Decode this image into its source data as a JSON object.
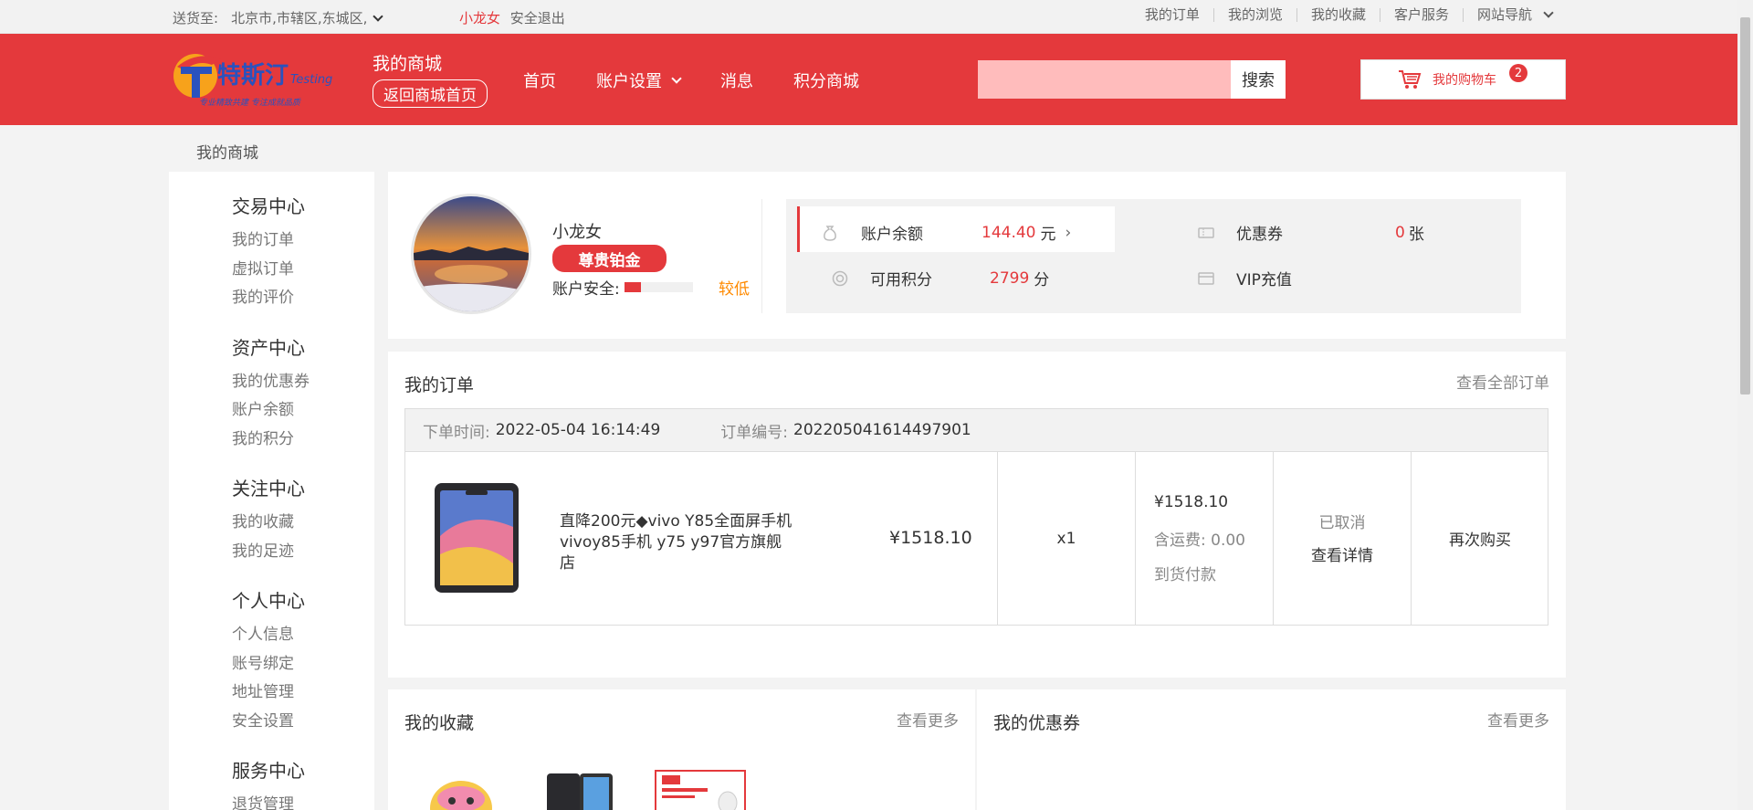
{
  "topbar": {
    "ship_to_label": "送货至:",
    "address": "北京市,市辖区,东城区,",
    "username": "小龙女",
    "logout": "安全退出",
    "links": [
      "我的订单",
      "我的浏览",
      "我的收藏",
      "客户服务",
      "网站导航"
    ]
  },
  "header": {
    "logo_text": "特斯汀",
    "logo_sub": "Testing",
    "logo_slogan": "专业精致共建 专注成就品质",
    "mall_title": "我的商城",
    "back_home": "返回商城首页",
    "nav": [
      "首页",
      "账户设置",
      "消息",
      "积分商城"
    ],
    "search_button": "搜索",
    "search_placeholder": "",
    "cart_label": "我的购物车",
    "cart_count": "2",
    "accent_color": "#e4393c"
  },
  "breadcrumb": "我的商城",
  "sidebar": [
    {
      "title": "交易中心",
      "links": [
        "我的订单",
        "虚拟订单",
        "我的评价"
      ]
    },
    {
      "title": "资产中心",
      "links": [
        "我的优惠券",
        "账户余额",
        "我的积分"
      ]
    },
    {
      "title": "关注中心",
      "links": [
        "我的收藏",
        "我的足迹"
      ]
    },
    {
      "title": "个人中心",
      "links": [
        "个人信息",
        "账号绑定",
        "地址管理",
        "安全设置"
      ]
    },
    {
      "title": "服务中心",
      "links": [
        "退货管理"
      ]
    }
  ],
  "profile": {
    "name": "小龙女",
    "level": "尊贵铂金",
    "security_label": "账户安全:",
    "security_level": "较低",
    "security_fraction": 0.25,
    "balance_label": "账户余额",
    "balance_value": "144.40",
    "balance_unit": "元",
    "coupon_label": "优惠券",
    "coupon_value": "0",
    "coupon_unit": "张",
    "points_label": "可用积分",
    "points_value": "2799",
    "points_unit": "分",
    "vip_label": "VIP充值"
  },
  "orders": {
    "title": "我的订单",
    "view_all": "查看全部订单",
    "time_label": "下单时间:",
    "time_value": "2022-05-04 16:14:49",
    "no_label": "订单编号:",
    "no_value": "202205041614497901",
    "product_name": "直降200元◆vivo Y85全面屏手机 vivoy85手机 y75 y97官方旗舰店",
    "unit_price": "¥1518.10",
    "quantity": "x1",
    "total": "¥1518.10",
    "shipping": "含运费: 0.00",
    "payment": "到货付款",
    "status": "已取消",
    "details": "查看详情",
    "rebuy": "再次购买"
  },
  "favorites": {
    "title": "我的收藏",
    "more": "查看更多"
  },
  "coupons": {
    "title": "我的优惠券",
    "more": "查看更多"
  }
}
